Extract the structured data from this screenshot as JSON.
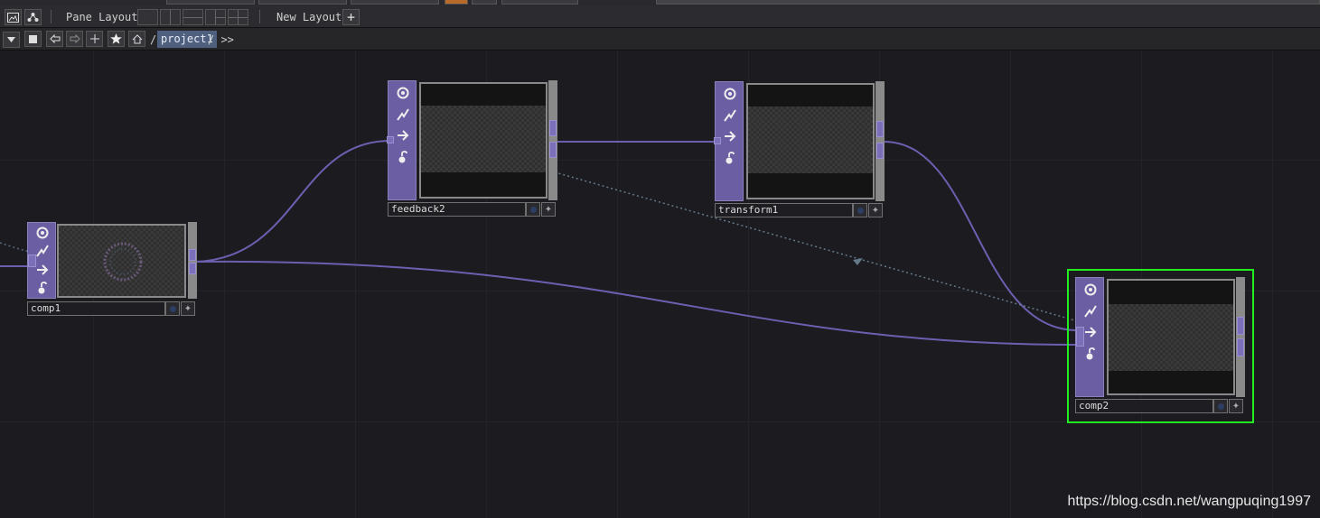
{
  "toolbar": {
    "pane_layout_label": "Pane Layout",
    "new_layout_label": "New Layout",
    "add_glyph": "+"
  },
  "pathbar": {
    "root_sep": "/",
    "path_item": "project1",
    "trail": "/ >>"
  },
  "nodes": {
    "feedback2": {
      "name": "feedback2"
    },
    "transform1": {
      "name": "transform1"
    },
    "comp1": {
      "name": "comp1"
    },
    "comp2": {
      "name": "comp2"
    }
  },
  "watermark": "https://blog.csdn.net/wangpuqing1997",
  "colors": {
    "background": "#1b1b20",
    "grid": "#2a2a33",
    "wire": "#6d5fb0",
    "node_sidebar": "#6c5ea3",
    "selected_outline": "#22ee22",
    "crumb": "#4f5f7e"
  },
  "icons": {
    "node_flags": [
      "viewer-icon",
      "bypass-icon",
      "arrow-right-icon",
      "lock-icon"
    ],
    "toolbar": [
      "image-icon",
      "network-icon",
      "dropdown-icon",
      "stop-icon",
      "back-icon",
      "forward-icon",
      "add-icon",
      "star-icon",
      "home-icon"
    ]
  }
}
